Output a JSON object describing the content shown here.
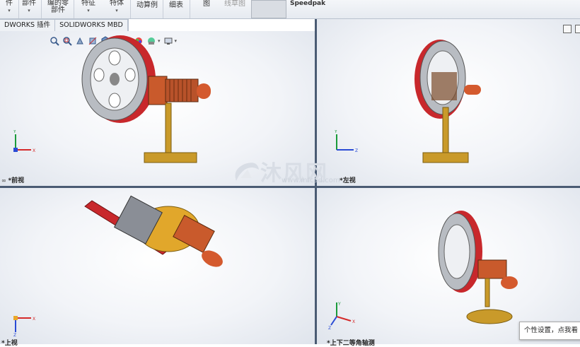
{
  "ribbon": {
    "items": [
      {
        "label": "件",
        "has_arrow": true
      },
      {
        "label": "部件",
        "has_arrow": true
      },
      {
        "label": "编的零\n部件",
        "has_arrow": false
      },
      {
        "label": "特征",
        "has_arrow": true
      },
      {
        "label": "特体",
        "has_arrow": true
      },
      {
        "label": "动算例",
        "has_arrow": false
      },
      {
        "label": "细表",
        "has_arrow": false
      },
      {
        "label": "图",
        "has_arrow": false
      },
      {
        "label": "线草图",
        "has_arrow": false
      }
    ],
    "speedpak_label": "Speedpak"
  },
  "tabs": [
    {
      "label": "DWORKS 插件"
    },
    {
      "label": "SOLIDWORKS MBD"
    }
  ],
  "views": {
    "front": "*前视",
    "left": "*左视",
    "top": "*上视",
    "iso": "*上下二等角轴测"
  },
  "axis_labels": {
    "x": "X",
    "y": "Y",
    "z": "Z"
  },
  "watermark": {
    "text": "沐风网",
    "url": "www.mfcad.com"
  },
  "tooltip": {
    "text": "个性设置，点我看"
  },
  "colors": {
    "viewport_divider": "#4a5b73",
    "wheel_rim": "#c8282c",
    "copper": "#c95a2c",
    "brass": "#c99a2a"
  },
  "toolbar_icons": [
    "zoom-to-fit-icon",
    "zoom-area-icon",
    "previous-view-icon",
    "section-view-icon",
    "view-orientation-icon",
    "display-style-icon",
    "hide-show-icon",
    "edit-appearance-icon",
    "apply-scene-icon",
    "view-settings-icon"
  ]
}
